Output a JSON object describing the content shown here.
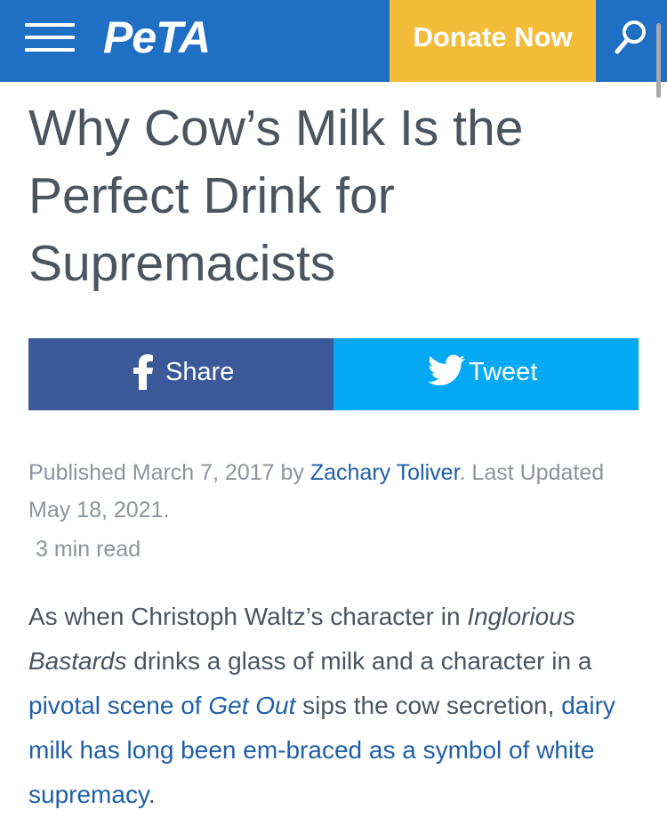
{
  "header": {
    "menu_icon": "hamburger-menu-icon",
    "logo": "PeTA",
    "donate_label": "Donate Now",
    "search_icon": "search-icon",
    "colors": {
      "bar": "#1f6fc5",
      "donate": "#f3bd3a"
    }
  },
  "article": {
    "title": "Why Cow’s Milk Is the Perfect Drink for Supremacists"
  },
  "share": {
    "facebook_label": "Share",
    "facebook_icon": "facebook-icon",
    "twitter_label": "Tweet",
    "twitter_icon": "twitter-icon",
    "colors": {
      "facebook": "#3b5998",
      "twitter": "#03a9f4"
    }
  },
  "meta": {
    "published_prefix": "Published March 7, 2017 by ",
    "author": "Zachary Toliver",
    "updated_suffix": ". Last Updated May 18, 2021.",
    "read_time": "3 min read"
  },
  "paragraph": {
    "p1": "As when Christoph Waltz’s character in ",
    "film1": "Inglorious Bastards",
    "p2": " drinks a glass of milk and a character in a ",
    "link1_text": "pivotal scene of ",
    "link1_film": "Get Out",
    "p3": " sips the cow secretion, ",
    "link2_text": "dairy milk has long been em-braced as a symbol of white supremacy",
    "p4": "."
  }
}
